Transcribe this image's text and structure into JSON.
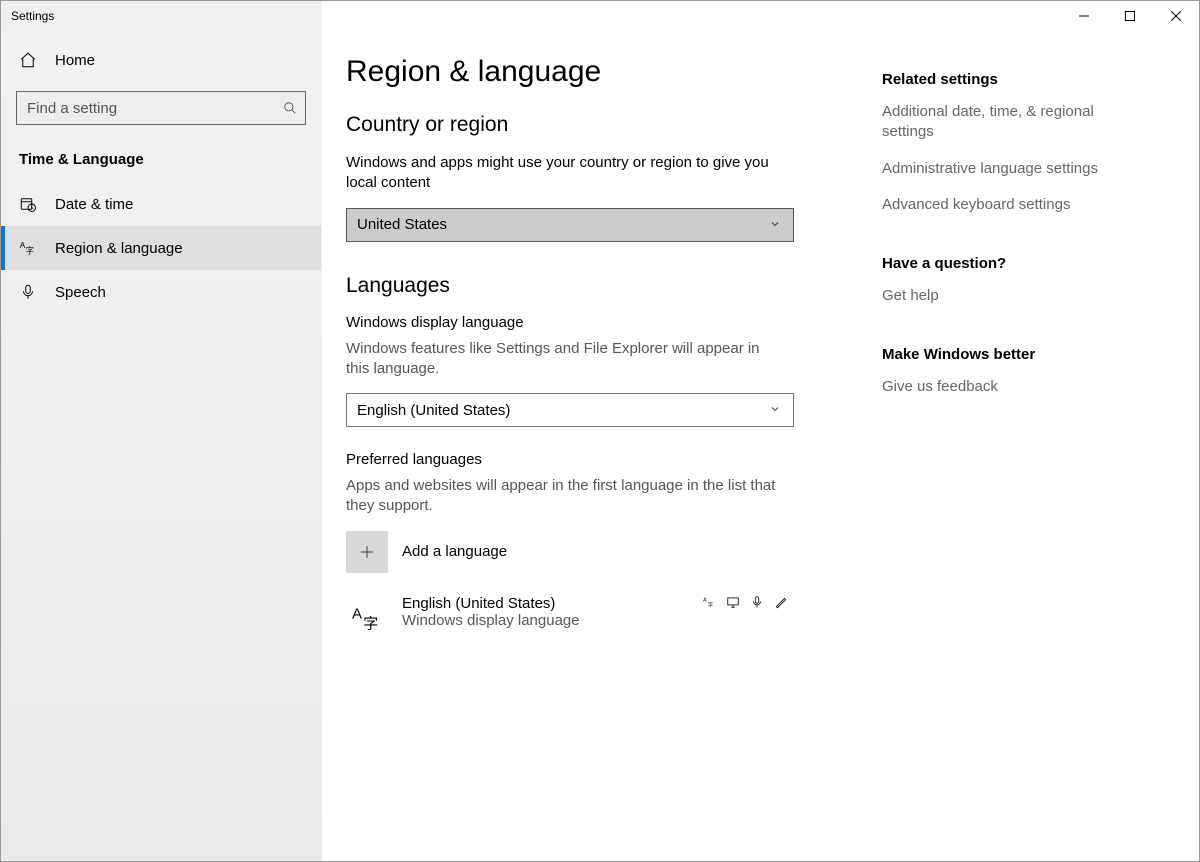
{
  "window": {
    "title": "Settings"
  },
  "sidebar": {
    "home": "Home",
    "search_placeholder": "Find a setting",
    "category": "Time & Language",
    "items": [
      {
        "label": "Date & time"
      },
      {
        "label": "Region & language"
      },
      {
        "label": "Speech"
      }
    ],
    "selected_index": 1
  },
  "page": {
    "title": "Region & language",
    "country_section": {
      "heading": "Country or region",
      "desc": "Windows and apps might use your country or region to give you local content",
      "value": "United States"
    },
    "languages_section": {
      "heading": "Languages",
      "display_label": "Windows display language",
      "display_desc": "Windows features like Settings and File Explorer will appear in this language.",
      "display_value": "English (United States)",
      "preferred_label": "Preferred languages",
      "preferred_desc": "Apps and websites will appear in the first language in the list that they support.",
      "add_label": "Add a language",
      "languages": [
        {
          "name": "English (United States)",
          "sub": "Windows display language"
        }
      ]
    }
  },
  "rail": {
    "related_heading": "Related settings",
    "links": [
      "Additional date, time, & regional settings",
      "Administrative language settings",
      "Advanced keyboard settings"
    ],
    "question_heading": "Have a question?",
    "help_link": "Get help",
    "improve_heading": "Make Windows better",
    "feedback_link": "Give us feedback"
  }
}
